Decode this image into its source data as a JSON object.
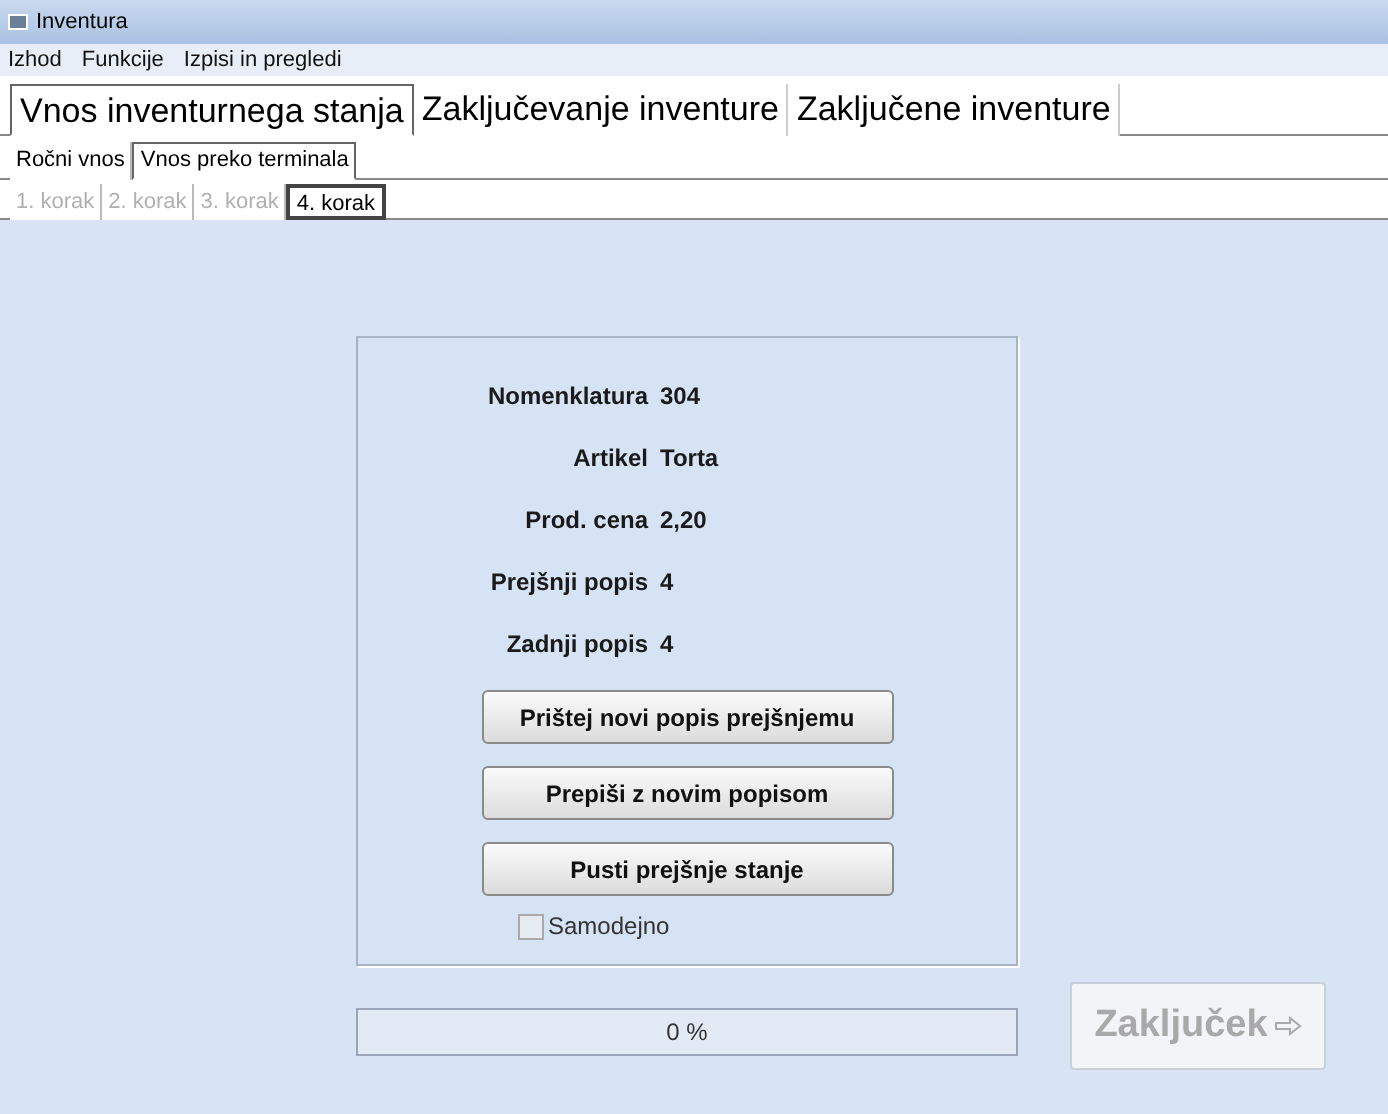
{
  "window": {
    "title": "Inventura"
  },
  "menu": [
    "Izhod",
    "Funkcije",
    "Izpisi in pregledi"
  ],
  "main_tabs": [
    {
      "label": "Vnos inventurnega stanja",
      "selected": true
    },
    {
      "label": "Zaključevanje inventure",
      "selected": false
    },
    {
      "label": "Zaključene inventure",
      "selected": false
    }
  ],
  "sub_tabs": [
    {
      "label": "Ročni vnos",
      "selected": false
    },
    {
      "label": "Vnos preko terminala",
      "selected": true
    }
  ],
  "step_tabs": [
    {
      "label": "1. korak",
      "selected": false,
      "disabled": true
    },
    {
      "label": "2. korak",
      "selected": false,
      "disabled": true
    },
    {
      "label": "3. korak",
      "selected": false,
      "disabled": true
    },
    {
      "label": "4. korak",
      "selected": true,
      "disabled": false
    }
  ],
  "fields": [
    {
      "label": "Nomenklatura",
      "value": "304"
    },
    {
      "label": "Artikel",
      "value": "Torta"
    },
    {
      "label": "Prod. cena",
      "value": "2,20"
    },
    {
      "label": "Prejšnji popis",
      "value": "4"
    },
    {
      "label": "Zadnji popis",
      "value": "4"
    }
  ],
  "buttons": [
    "Prištej novi popis prejšnjemu",
    "Prepiši z novim popisom",
    "Pusti prejšnje stanje"
  ],
  "auto_checkbox": {
    "label": "Samodejno",
    "checked": false
  },
  "progress": {
    "level": 0,
    "reading": "0 %"
  },
  "finish_button": {
    "label": "Zaključek",
    "disabled": true
  }
}
